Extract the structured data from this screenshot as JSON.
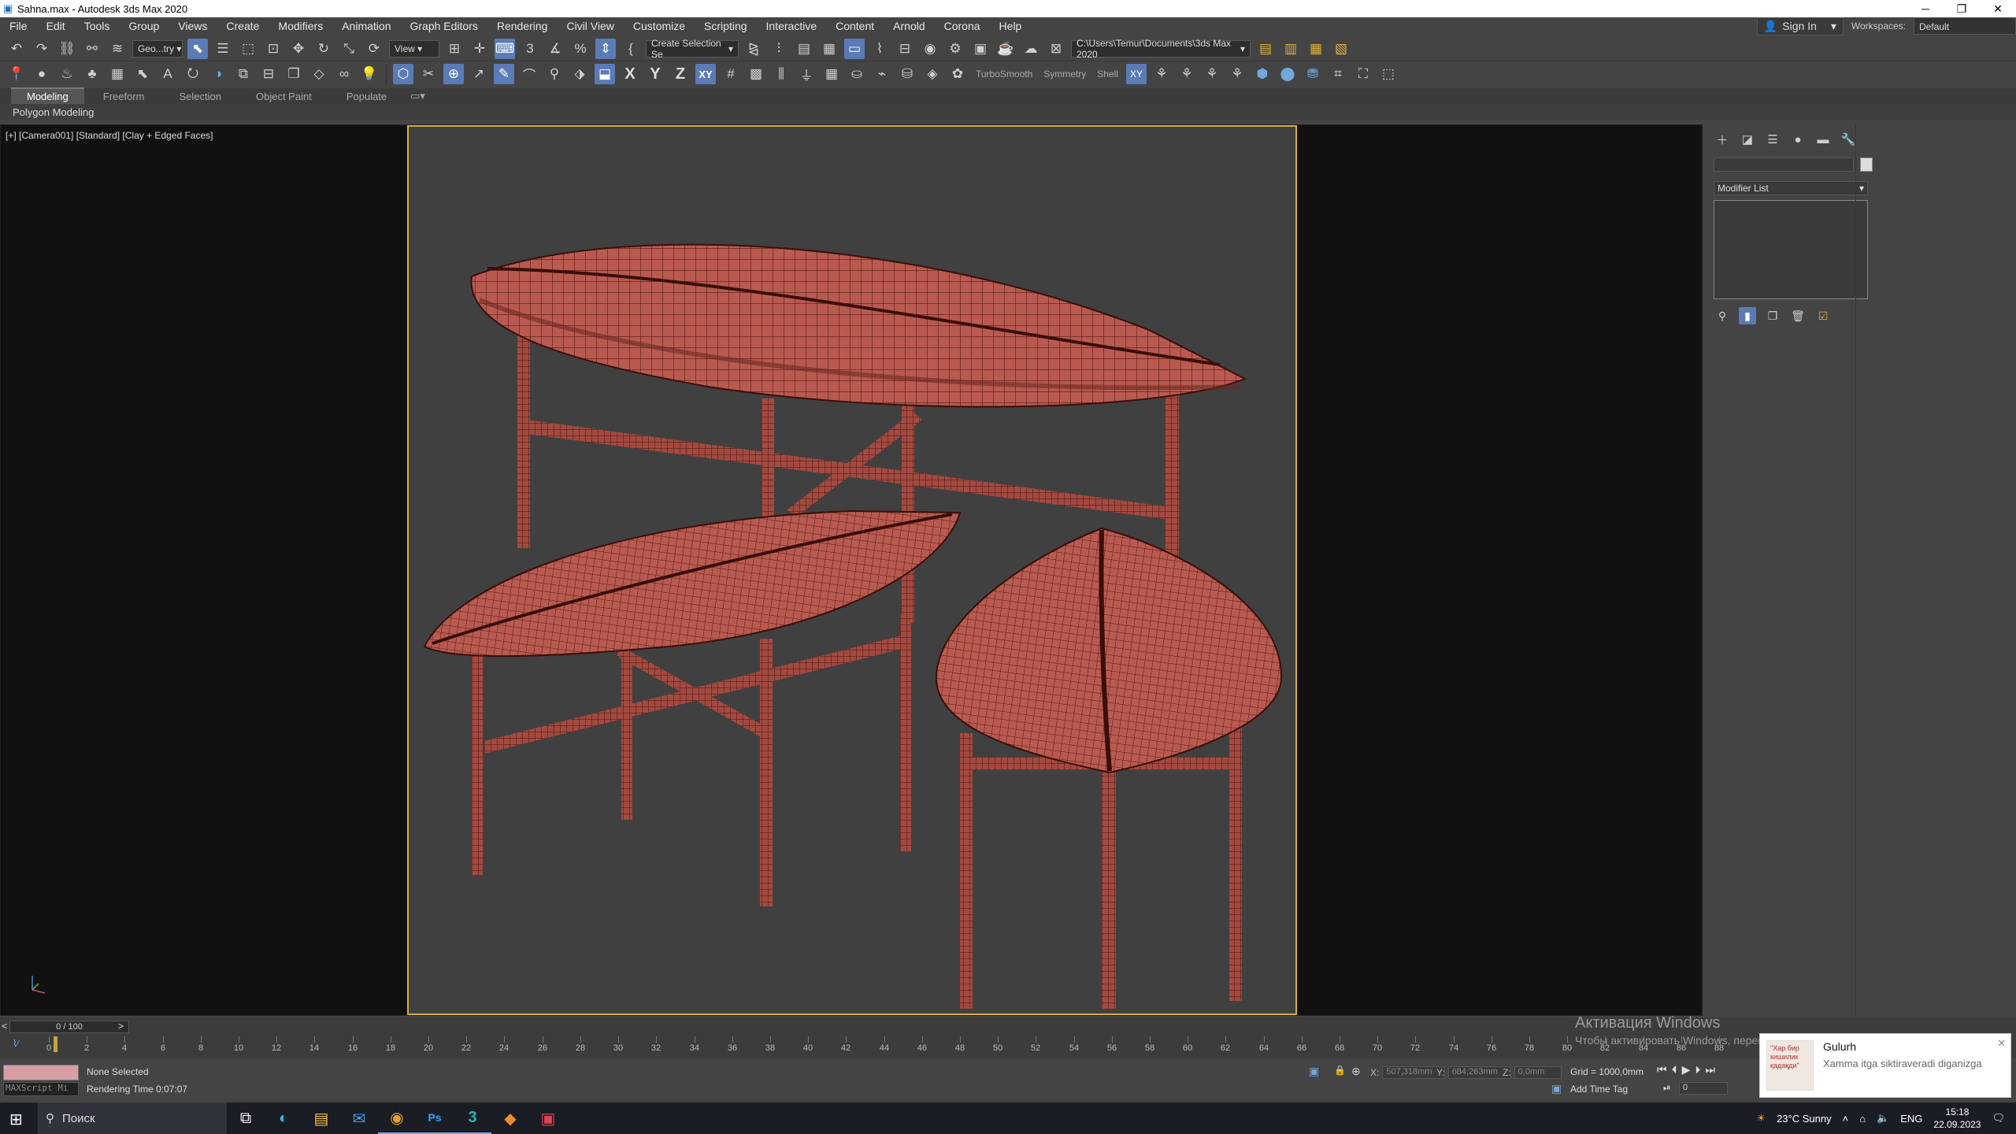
{
  "window": {
    "title": "Sahna.max - Autodesk 3ds Max 2020"
  },
  "menu": [
    "File",
    "Edit",
    "Tools",
    "Group",
    "Views",
    "Create",
    "Modifiers",
    "Animation",
    "Graph Editors",
    "Rendering",
    "Civil View",
    "Customize",
    "Scripting",
    "Interactive",
    "Content",
    "Arnold",
    "Corona",
    "Help"
  ],
  "account": {
    "sign_in": "Sign In",
    "workspaces_label": "Workspaces:",
    "workspace_value": "Default"
  },
  "toolbar": {
    "selection_filter": "Geo...try",
    "ref_coord": "View",
    "named_selection": "Create Selection Se",
    "project_path": "C:\\Users\\Temur\\Documents\\3ds Max 2020",
    "turbosmooth": "TurboSmooth",
    "symmetry": "Symmetry",
    "shell": "Shell",
    "axis_x": "X",
    "axis_y": "Y",
    "axis_z": "Z",
    "axis_xy": "XY"
  },
  "ribbon": {
    "tabs": [
      "Modeling",
      "Freeform",
      "Selection",
      "Object Paint",
      "Populate"
    ],
    "active_tab": "Modeling",
    "sub_label": "Polygon Modeling"
  },
  "viewport": {
    "label": "[+] [Camera001] [Standard] [Clay + Edged Faces]"
  },
  "command_panel": {
    "modifier_list": "Modifier List"
  },
  "timeline": {
    "slider": "0 / 100",
    "ticks": [
      "0",
      "2",
      "4",
      "6",
      "8",
      "10",
      "12",
      "14",
      "16",
      "18",
      "20",
      "22",
      "24",
      "26",
      "28",
      "30",
      "32",
      "34",
      "36",
      "38",
      "40",
      "42",
      "44",
      "46",
      "48",
      "50",
      "52",
      "54",
      "56",
      "58",
      "60",
      "62",
      "64",
      "66",
      "68",
      "70",
      "72",
      "74",
      "76",
      "78",
      "80",
      "82",
      "84",
      "86",
      "88"
    ]
  },
  "status": {
    "maxscript": "MAXScript Mi",
    "selection": "None Selected",
    "rendering_time": "Rendering Time  0:07:07",
    "x_label": "X:",
    "x_value": "507,318mm",
    "y_label": "Y:",
    "y_value": "684,263mm",
    "z_label": "Z:",
    "z_value": "0,0mm",
    "grid": "Grid = 1000,0mm",
    "add_time_tag": "Add Time Tag",
    "frame": "0"
  },
  "windows_activation": {
    "title": "Активация Windows",
    "subtitle": "Чтобы активировать Windows, перейдите в раздел \"Параметры\"."
  },
  "notification": {
    "title": "Gulurh",
    "body": "Xamma itga siktiraveradi diganizga",
    "thumb_text": "\"Хар бир кишилик қадақди\""
  },
  "taskbar": {
    "search": "Поиск",
    "weather": "23°C  Sunny",
    "lang": "ENG",
    "time": "15:18",
    "date": "22.09.2023"
  },
  "colors": {
    "accent": "#5a7bb5",
    "safe_frame": "#d4b040",
    "mesh_fill": "#b85a50",
    "mesh_wire": "#5a1a14"
  }
}
